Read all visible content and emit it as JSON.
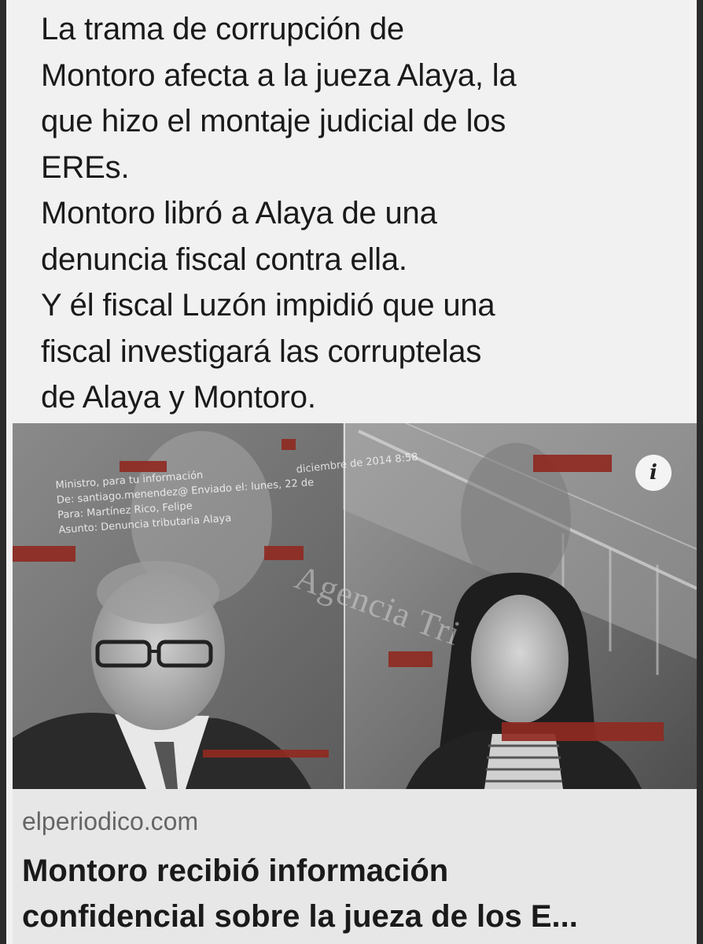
{
  "post": {
    "lines": [
      "La trama de corrupción de",
      "Montoro afecta a la jueza Alaya, la",
      "que hizo el montaje judicial de los",
      "EREs.",
      "Montoro libró a Alaya de una",
      "denuncia fiscal contra ella.",
      "Y él fiscal Luzón impidió que una",
      "fiscal investigará las corruptelas",
      "de Alaya y Montoro."
    ]
  },
  "link_card": {
    "image": {
      "overlay_doc_lines": [
        "Ministro, para tu información",
        "De: santiago.menendez@ Enviado el: lunes, 22 de",
        "Para: Martínez Rico, Felipe",
        "Asunto: Denuncia tributaria Alaya"
      ],
      "overlay_date": "diciembre de 2014 8:58",
      "building_sign": "Agencia Tri",
      "info_icon": "info-icon"
    },
    "domain": "elperiodico.com",
    "title_lines": [
      "Montoro recibió información",
      "confidencial sobre la jueza de los E..."
    ]
  },
  "colors": {
    "page_bg": "#f1f1f1",
    "frame_bg": "#2b2b2b",
    "card_bg": "#e7e7e7",
    "redaction_bar": "#8e2a22"
  }
}
